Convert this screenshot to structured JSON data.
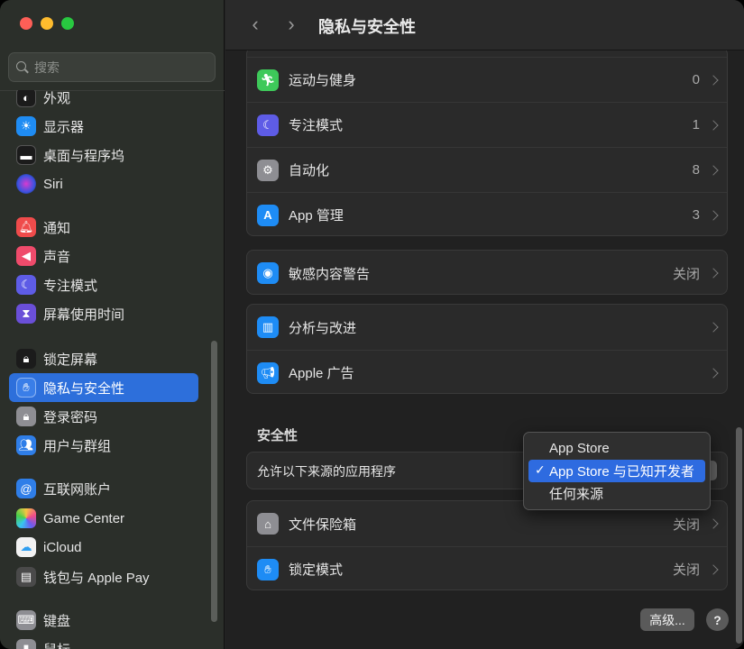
{
  "window": {
    "search_placeholder": "搜索",
    "page_title": "隐私与安全性"
  },
  "sidebar": {
    "items": [
      {
        "label": "外观",
        "icon": "appearance-icon"
      },
      {
        "label": "显示器",
        "icon": "display-icon"
      },
      {
        "label": "桌面与程序坞",
        "icon": "dock-icon"
      },
      {
        "label": "Siri",
        "icon": "siri-icon"
      },
      {
        "label": "通知",
        "icon": "bell-icon"
      },
      {
        "label": "声音",
        "icon": "speaker-icon"
      },
      {
        "label": "专注模式",
        "icon": "moon-icon"
      },
      {
        "label": "屏幕使用时间",
        "icon": "hourglass-icon"
      },
      {
        "label": "锁定屏幕",
        "icon": "lock-icon"
      },
      {
        "label": "隐私与安全性",
        "icon": "hand-icon",
        "selected": true
      },
      {
        "label": "登录密码",
        "icon": "padlock-icon"
      },
      {
        "label": "用户与群组",
        "icon": "users-icon"
      },
      {
        "label": "互联网账户",
        "icon": "at-icon"
      },
      {
        "label": "Game Center",
        "icon": "game-center-icon"
      },
      {
        "label": "iCloud",
        "icon": "cloud-icon"
      },
      {
        "label": "钱包与 Apple Pay",
        "icon": "wallet-icon"
      },
      {
        "label": "键盘",
        "icon": "keyboard-icon"
      },
      {
        "label": "鼠标",
        "icon": "mouse-icon"
      }
    ]
  },
  "privacy_group": {
    "rows": [
      {
        "label": "运动与健身",
        "value": "0",
        "icon": "fitness-icon"
      },
      {
        "label": "专注模式",
        "value": "1",
        "icon": "moon-icon"
      },
      {
        "label": "自动化",
        "value": "8",
        "icon": "gears-icon"
      },
      {
        "label": "App 管理",
        "value": "3",
        "icon": "app-store-icon"
      }
    ]
  },
  "sensitive_group": {
    "rows": [
      {
        "label": "敏感内容警告",
        "value": "关闭",
        "icon": "eye-icon"
      }
    ]
  },
  "analytics_group": {
    "rows": [
      {
        "label": "分析与改进",
        "icon": "chart-icon"
      },
      {
        "label": "Apple 广告",
        "icon": "megaphone-icon"
      }
    ]
  },
  "security": {
    "section_title": "安全性",
    "allow_label": "允许以下来源的应用程序",
    "popup_options": [
      "App Store",
      "App Store 与已知开发者",
      "任何来源"
    ],
    "popup_selected_index": 1,
    "check_mark": "✓"
  },
  "vault_group": {
    "rows": [
      {
        "label": "文件保险箱",
        "value": "关闭",
        "icon": "house-icon"
      },
      {
        "label": "锁定模式",
        "value": "关闭",
        "icon": "hand-icon"
      }
    ]
  },
  "footer": {
    "advanced_label": "高级...",
    "help_label": "?"
  },
  "colors": {
    "accent": "#2d6fdb",
    "fitness": "#3ec95a",
    "focus": "#5e5ce6",
    "automation": "#8e8e93",
    "app_store": "#1e8cf5"
  }
}
